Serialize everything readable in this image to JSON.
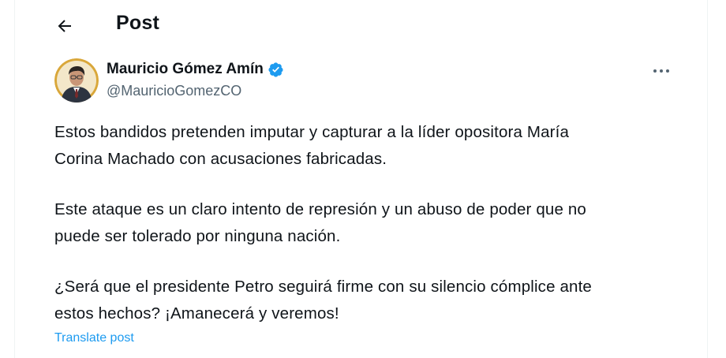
{
  "header": {
    "title": "Post"
  },
  "author": {
    "name": "Mauricio Gómez Amín",
    "handle": "@MauricioGomezCO",
    "verified_icon": "verified-badge-icon",
    "verified_color": "#1d9bf0"
  },
  "tweet": {
    "paragraphs": [
      {
        "line1": "Estos bandidos pretenden imputar y capturar a la líder opositora María",
        "line2": "Corina Machado con acusaciones fabricadas."
      },
      {
        "line1": "Este ataque es un claro intento de represión y un abuso de poder que no",
        "line2": "puede ser tolerado por ninguna nación."
      },
      {
        "line1": "¿Será que el presidente Petro seguirá firme con su silencio cómplice ante",
        "line2": "estos hechos? ¡Amanecerá y veremos!"
      }
    ],
    "translate_label": "Translate post"
  },
  "icons": {
    "back": "back-arrow-icon",
    "more": "more-dots-icon"
  },
  "colors": {
    "accent": "#1d9bf0",
    "text": "#0f1419",
    "secondary": "#536471"
  }
}
